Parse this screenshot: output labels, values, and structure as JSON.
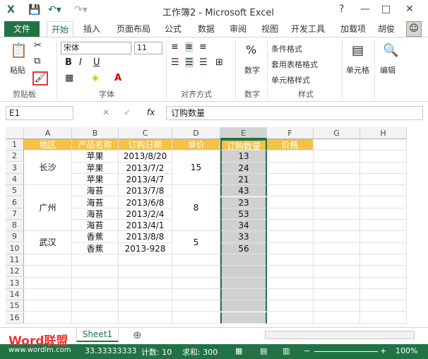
{
  "window": {
    "title": "工作簿2 - Microsoft Excel",
    "controls": [
      "?",
      "—",
      "□",
      "✕"
    ]
  },
  "menu": {
    "file": "文件",
    "tabs": [
      "开始",
      "插入",
      "页面布局",
      "公式",
      "数据",
      "审阅",
      "视图",
      "开发工具",
      "加载项"
    ],
    "user": "胡俊"
  },
  "ribbon": {
    "clipboard": {
      "label": "剪贴板",
      "paste": "粘贴"
    },
    "font": {
      "label": "字体",
      "name": "宋体",
      "size": "11",
      "bold": "B",
      "italic": "I",
      "underline": "U"
    },
    "align": {
      "label": "对齐方式"
    },
    "number": {
      "label": "数字",
      "percent": "%"
    },
    "styles": {
      "label": "样式",
      "cond": "条件格式",
      "table": "套用表格格式",
      "cell": "单元格样式"
    },
    "cells": {
      "label": "单元格"
    },
    "edit": {
      "label": "编辑"
    }
  },
  "formula": {
    "namebox": "E1",
    "fx": "fx",
    "content": "订购数量"
  },
  "columns": [
    "A",
    "B",
    "C",
    "D",
    "E",
    "F",
    "G",
    "H"
  ],
  "rows": [
    "1",
    "2",
    "3",
    "4",
    "5",
    "6",
    "7",
    "8",
    "9",
    "10",
    "11",
    "12",
    "13",
    "14",
    "15",
    "16"
  ],
  "headers": [
    "地区",
    "产品名称",
    "订购日期",
    "单价",
    "订购数量",
    "价格"
  ],
  "data": {
    "regions": [
      "长沙",
      "广州",
      "武汉"
    ],
    "products": [
      "苹果",
      "苹果",
      "苹果",
      "海苔",
      "海苔",
      "海苔",
      "海苔",
      "香蕉",
      "香蕉"
    ],
    "dates": [
      "2013/8/20",
      "2013/7/2",
      "2013/4/7",
      "2013/7/8",
      "2013/6/8",
      "2013/2/4",
      "2013/4/1",
      "2013/8/8",
      "2013-928"
    ],
    "prices": [
      "15",
      "8",
      "5"
    ],
    "qty": [
      "13",
      "24",
      "21",
      "43",
      "23",
      "53",
      "34",
      "33",
      "56"
    ]
  },
  "sheet": {
    "name": "Sheet1",
    "add": "⊕"
  },
  "status": {
    "average": "33.33333333",
    "count": "计数: 10",
    "sum": "求和: 300",
    "zoom": "100%"
  },
  "watermark": {
    "brand": "Word联盟",
    "url": "www.wordlm.com"
  }
}
